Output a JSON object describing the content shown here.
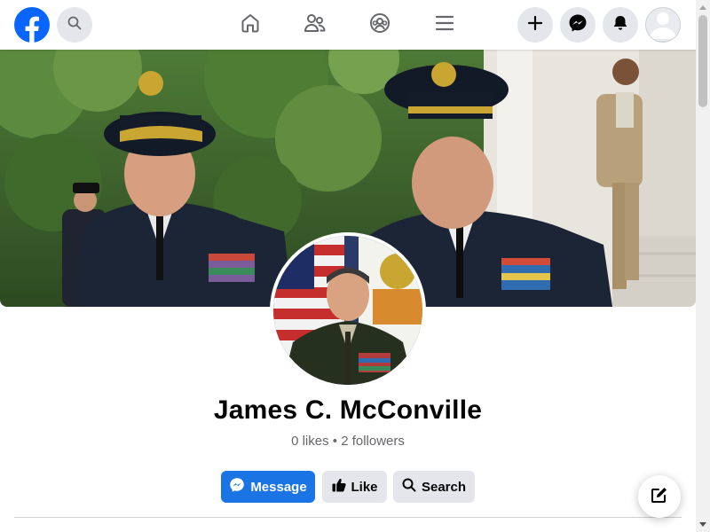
{
  "nav": {
    "logo_icon": "facebook-logo-icon",
    "search_icon": "search-icon",
    "tabs": [
      {
        "icon": "home-icon"
      },
      {
        "icon": "friends-icon"
      },
      {
        "icon": "groups-icon"
      },
      {
        "icon": "menu-icon"
      }
    ],
    "right_icons": [
      "plus-icon",
      "messenger-icon",
      "bell-icon",
      "avatar-icon"
    ]
  },
  "colors": {
    "brand": "#0866ff",
    "primary_button": "#1b74e4",
    "secondary_button": "#e4e6eb",
    "text_primary": "#050505",
    "text_secondary": "#65676b"
  },
  "profile": {
    "name": "James C. McConville",
    "stats": "0 likes • 2 followers"
  },
  "actions": {
    "message_label": "Message",
    "like_label": "Like",
    "search_label": "Search"
  },
  "fab": {
    "icon": "compose-icon"
  }
}
